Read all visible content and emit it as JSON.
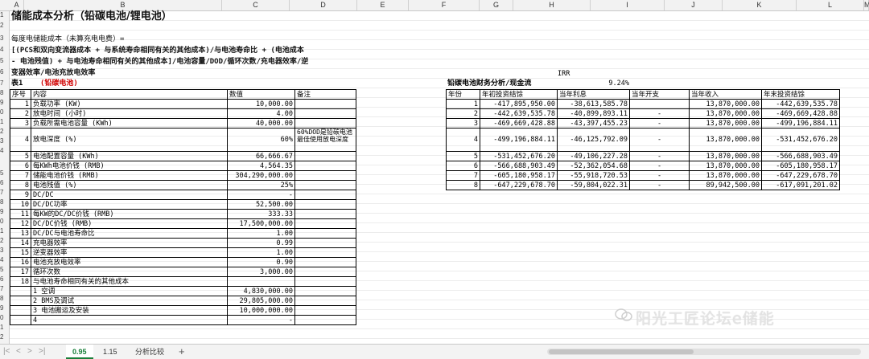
{
  "columns": [
    "A",
    "B",
    "C",
    "D",
    "E",
    "F",
    "G",
    "H",
    "I",
    "J",
    "K",
    "L",
    "M"
  ],
  "rows": [
    "1",
    "2",
    "3",
    "4",
    "5",
    "6",
    "7",
    "8",
    "9",
    "0",
    "1",
    "2",
    "3",
    "4",
    "5",
    "6",
    "7",
    "8",
    "9",
    "0",
    "1",
    "2",
    "3",
    "4",
    "5",
    "6",
    "7",
    "8",
    "9",
    "0",
    "1",
    "2",
    "3",
    "4",
    "5"
  ],
  "title": "储能成本分析（铅碳电池/锂电池）",
  "formula_lines": [
    "每度电储能成本（未算充电电费）=",
    "[(PCS和双向变流器成本 + 与系统寿命相同有关的其他成本)/与电池寿命比 + (电池成本",
    "- 电池残值) + 与电池寿命相同有关的其他成本]/电池容量/DOD/循环次数/充电器效率/逆",
    "变器效率/电池充放电效率"
  ],
  "irr_label": "IRR",
  "irr_value": "9.24%",
  "table1": {
    "label": "表1",
    "type": "(铅碳电池)",
    "headers": [
      "序号",
      "内容",
      "数值",
      "备注"
    ],
    "rows": [
      {
        "no": "1",
        "name": "负载功率 (KW)",
        "val": "10,000.00",
        "note": ""
      },
      {
        "no": "2",
        "name": "放电时间 (小时)",
        "val": "4.00",
        "note": ""
      },
      {
        "no": "3",
        "name": "负载所需电池容量 (KWh)",
        "val": "40,000.00",
        "note": ""
      },
      {
        "no": "4",
        "name": "放电深度 (%)",
        "val": "60%",
        "note": "60%DOD是铅碳电池最佳使用放电深度"
      },
      {
        "no": "5",
        "name": "电池配置容量 (KWh)",
        "val": "66,666.67",
        "note": ""
      },
      {
        "no": "6",
        "name": "每KWh电池价钱 (RMB)",
        "val": "4,564.35",
        "note": ""
      },
      {
        "no": "7",
        "name": "储能电池价钱 (RMB)",
        "val": "304,290,000.00",
        "note": ""
      },
      {
        "no": "8",
        "name": "电池残值 (%)",
        "val": "25%",
        "note": ""
      },
      {
        "no": "9",
        "name": "DC/DC",
        "val": "-",
        "note": ""
      },
      {
        "no": "10",
        "name": "DC/DC功率",
        "val": "52,500.00",
        "note": ""
      },
      {
        "no": "11",
        "name": "每KW的DC/DC价钱 (RMB)",
        "val": "333.33",
        "note": ""
      },
      {
        "no": "12",
        "name": "DC/DC价钱 (RMB)",
        "val": "17,500,000.00",
        "note": ""
      },
      {
        "no": "13",
        "name": "DC/DC与电池寿命比",
        "val": "1.00",
        "note": ""
      },
      {
        "no": "14",
        "name": "充电器效率",
        "val": "0.99",
        "note": ""
      },
      {
        "no": "15",
        "name": "逆变器效率",
        "val": "1.00",
        "note": ""
      },
      {
        "no": "16",
        "name": "电池充放电效率",
        "val": "0.90",
        "note": ""
      },
      {
        "no": "17",
        "name": "循环次数",
        "val": "3,000.00",
        "note": ""
      },
      {
        "no": "18",
        "name": "与电池寿命相同有关的其他成本",
        "val": "",
        "note": ""
      },
      {
        "no": "",
        "name": "1 空调",
        "val": "4,830,000.00",
        "note": ""
      },
      {
        "no": "",
        "name": "2 BMS及调试",
        "val": "29,805,000.00",
        "note": ""
      },
      {
        "no": "",
        "name": "3 电池搬运及安装",
        "val": "10,000,000.00",
        "note": ""
      },
      {
        "no": "",
        "name": "4",
        "val": "-",
        "note": ""
      }
    ]
  },
  "table2": {
    "title": "铅碳电池财务分析/现金流",
    "headers": [
      "年份",
      "年初投资结馀",
      "当年利息",
      "当年开支",
      "当年收入",
      "年末投资结馀"
    ],
    "rows": [
      {
        "year": "1",
        "begin": "-417,895,950.00",
        "interest": "-38,613,585.78",
        "expense": "",
        "income": "13,870,000.00",
        "end": "-442,639,535.78"
      },
      {
        "year": "2",
        "begin": "-442,639,535.78",
        "interest": "-40,899,893.11",
        "expense": "-",
        "income": "13,870,000.00",
        "end": "-469,669,428.88"
      },
      {
        "year": "3",
        "begin": "-469,669,428.88",
        "interest": "-43,397,455.23",
        "expense": "-",
        "income": "13,870,000.00",
        "end": "-499,196,884.11"
      },
      {
        "year": "4",
        "begin": "-499,196,884.11",
        "interest": "-46,125,792.09",
        "expense": "-",
        "income": "13,870,000.00",
        "end": "-531,452,676.20"
      },
      {
        "year": "5",
        "begin": "-531,452,676.20",
        "interest": "-49,106,227.28",
        "expense": "-",
        "income": "13,870,000.00",
        "end": "-566,688,903.49"
      },
      {
        "year": "6",
        "begin": "-566,688,903.49",
        "interest": "-52,362,054.68",
        "expense": "-",
        "income": "13,870,000.00",
        "end": "-605,180,958.17"
      },
      {
        "year": "7",
        "begin": "-605,180,958.17",
        "interest": "-55,918,720.53",
        "expense": "-",
        "income": "13,870,000.00",
        "end": "-647,229,678.70"
      },
      {
        "year": "8",
        "begin": "-647,229,678.70",
        "interest": "-59,804,022.31",
        "expense": "-",
        "income": "89,942,500.00",
        "end": "-617,091,201.02"
      }
    ]
  },
  "tabs": [
    "0.95",
    "1.15",
    "分析比较"
  ],
  "active_tab": "0.95",
  "add_tab_glyph": "+",
  "nav": {
    "first": "|<",
    "prev": "<",
    "next": ">",
    "last": ">|"
  },
  "watermark": "阳光工匠论坛e储能"
}
